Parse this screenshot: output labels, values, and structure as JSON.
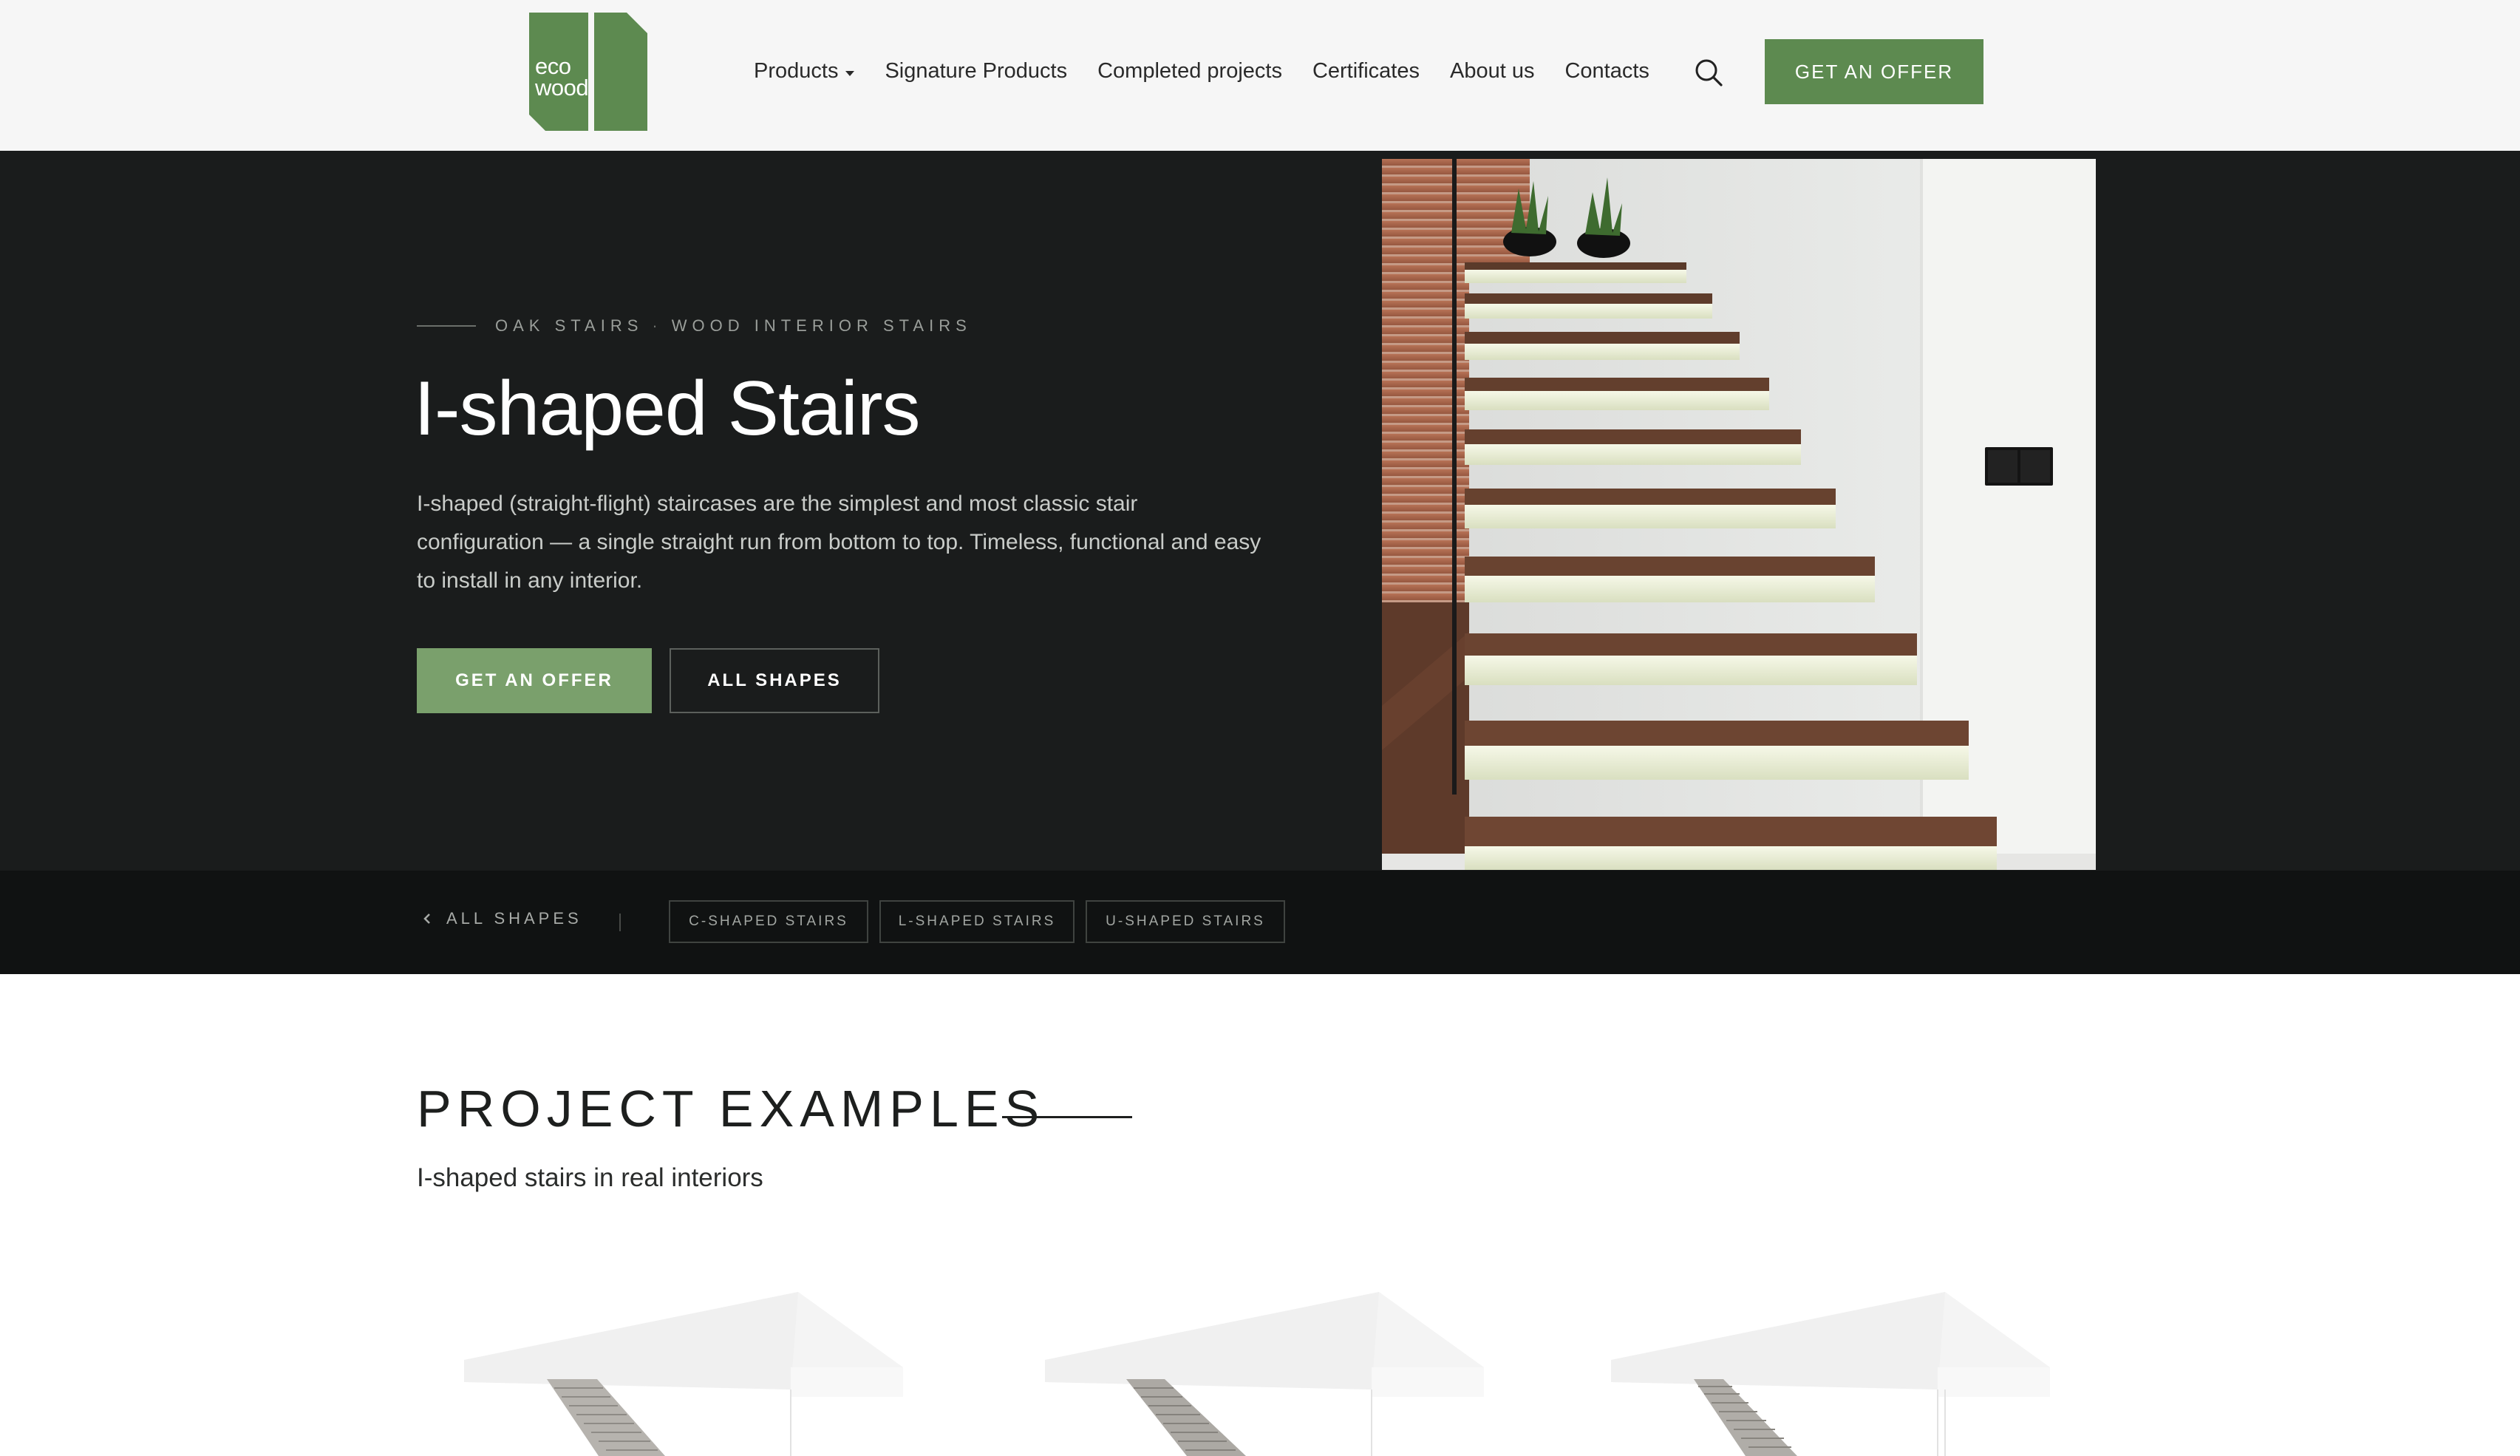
{
  "header": {
    "logo": {
      "line1": "eco",
      "line2": "wood",
      "color": "#5d8a50"
    },
    "nav": [
      {
        "label": "Products",
        "has_dropdown": true
      },
      {
        "label": "Signature Products"
      },
      {
        "label": "Completed projects"
      },
      {
        "label": "Certificates"
      },
      {
        "label": "About us"
      },
      {
        "label": "Contacts"
      }
    ],
    "search_icon": "search-icon",
    "cta_label": "GET AN OFFER"
  },
  "hero": {
    "breadcrumb": {
      "first": "OAK STAIRS",
      "separator": "·",
      "second": "WOOD INTERIOR STAIRS"
    },
    "title": "I-shaped Stairs",
    "description": "I-shaped (straight-flight) staircases are the simplest and most classic stair configuration — a single straight run from bottom to top. Timeless, functional and easy to install in any interior.",
    "primary_button": "GET AN OFFER",
    "secondary_button": "ALL SHAPES",
    "image": "illuminated-oak-staircase-photo"
  },
  "shapes_bar": {
    "back_label": "ALL SHAPES",
    "chips": [
      "C-SHAPED STAIRS",
      "L-SHAPED STAIRS",
      "U-SHAPED STAIRS"
    ]
  },
  "projects": {
    "title": "PROJECT EXAMPLES",
    "subtitle": "I-shaped stairs in real interiors",
    "cards": [
      "stair-render-1",
      "stair-render-2",
      "stair-render-3"
    ]
  },
  "colors": {
    "brand_green": "#5d8a50",
    "hero_bg": "#1a1c1c",
    "bar_bg": "#101212",
    "hero_button_green": "#7aa06c"
  }
}
